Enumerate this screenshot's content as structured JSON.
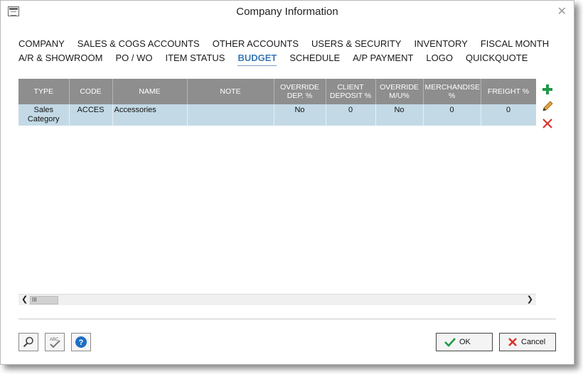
{
  "window": {
    "title": "Company Information",
    "close_glyph": "✕"
  },
  "tabs": {
    "row1": [
      "COMPANY",
      "SALES & COGS ACCOUNTS",
      "OTHER ACCOUNTS",
      "USERS & SECURITY",
      "INVENTORY",
      "FISCAL MONTH"
    ],
    "row2": [
      "A/R & SHOWROOM",
      "PO / WO",
      "ITEM STATUS",
      "BUDGET",
      "SCHEDULE",
      "A/P PAYMENT",
      "LOGO",
      "QUICKQUOTE"
    ],
    "active": "BUDGET"
  },
  "grid": {
    "columns": [
      {
        "label": "TYPE"
      },
      {
        "label": "CODE"
      },
      {
        "label": "NAME"
      },
      {
        "label": "NOTE"
      },
      {
        "label": "OVERRIDE DEP. %"
      },
      {
        "label": "CLIENT DEPOSIT %"
      },
      {
        "label": "OVERRIDE M/U%"
      },
      {
        "label": "MERCHANDISE %"
      },
      {
        "label": "FREIGHT %"
      }
    ],
    "rows": [
      [
        "Sales Category",
        "ACCES",
        "Accessories",
        "",
        "No",
        "0",
        "No",
        "0",
        "0"
      ]
    ]
  },
  "scrollbar": {
    "left_arrow": "❮",
    "thumb_grip": "III",
    "right_arrow": "❯"
  },
  "icons": {
    "side": [
      "add-icon",
      "edit-pencil-icon",
      "delete-x-icon"
    ],
    "bottom": [
      "search-icon",
      "spellcheck-icon",
      "help-icon"
    ]
  },
  "buttons": {
    "ok": "OK",
    "cancel": "Cancel"
  },
  "colors": {
    "header_bg": "#8e8e8e",
    "row_bg": "#c3dae6",
    "active_tab": "#3a78b5",
    "add_green": "#1e9a45",
    "delete_red": "#d9342b",
    "help_blue": "#1c6fc4"
  }
}
